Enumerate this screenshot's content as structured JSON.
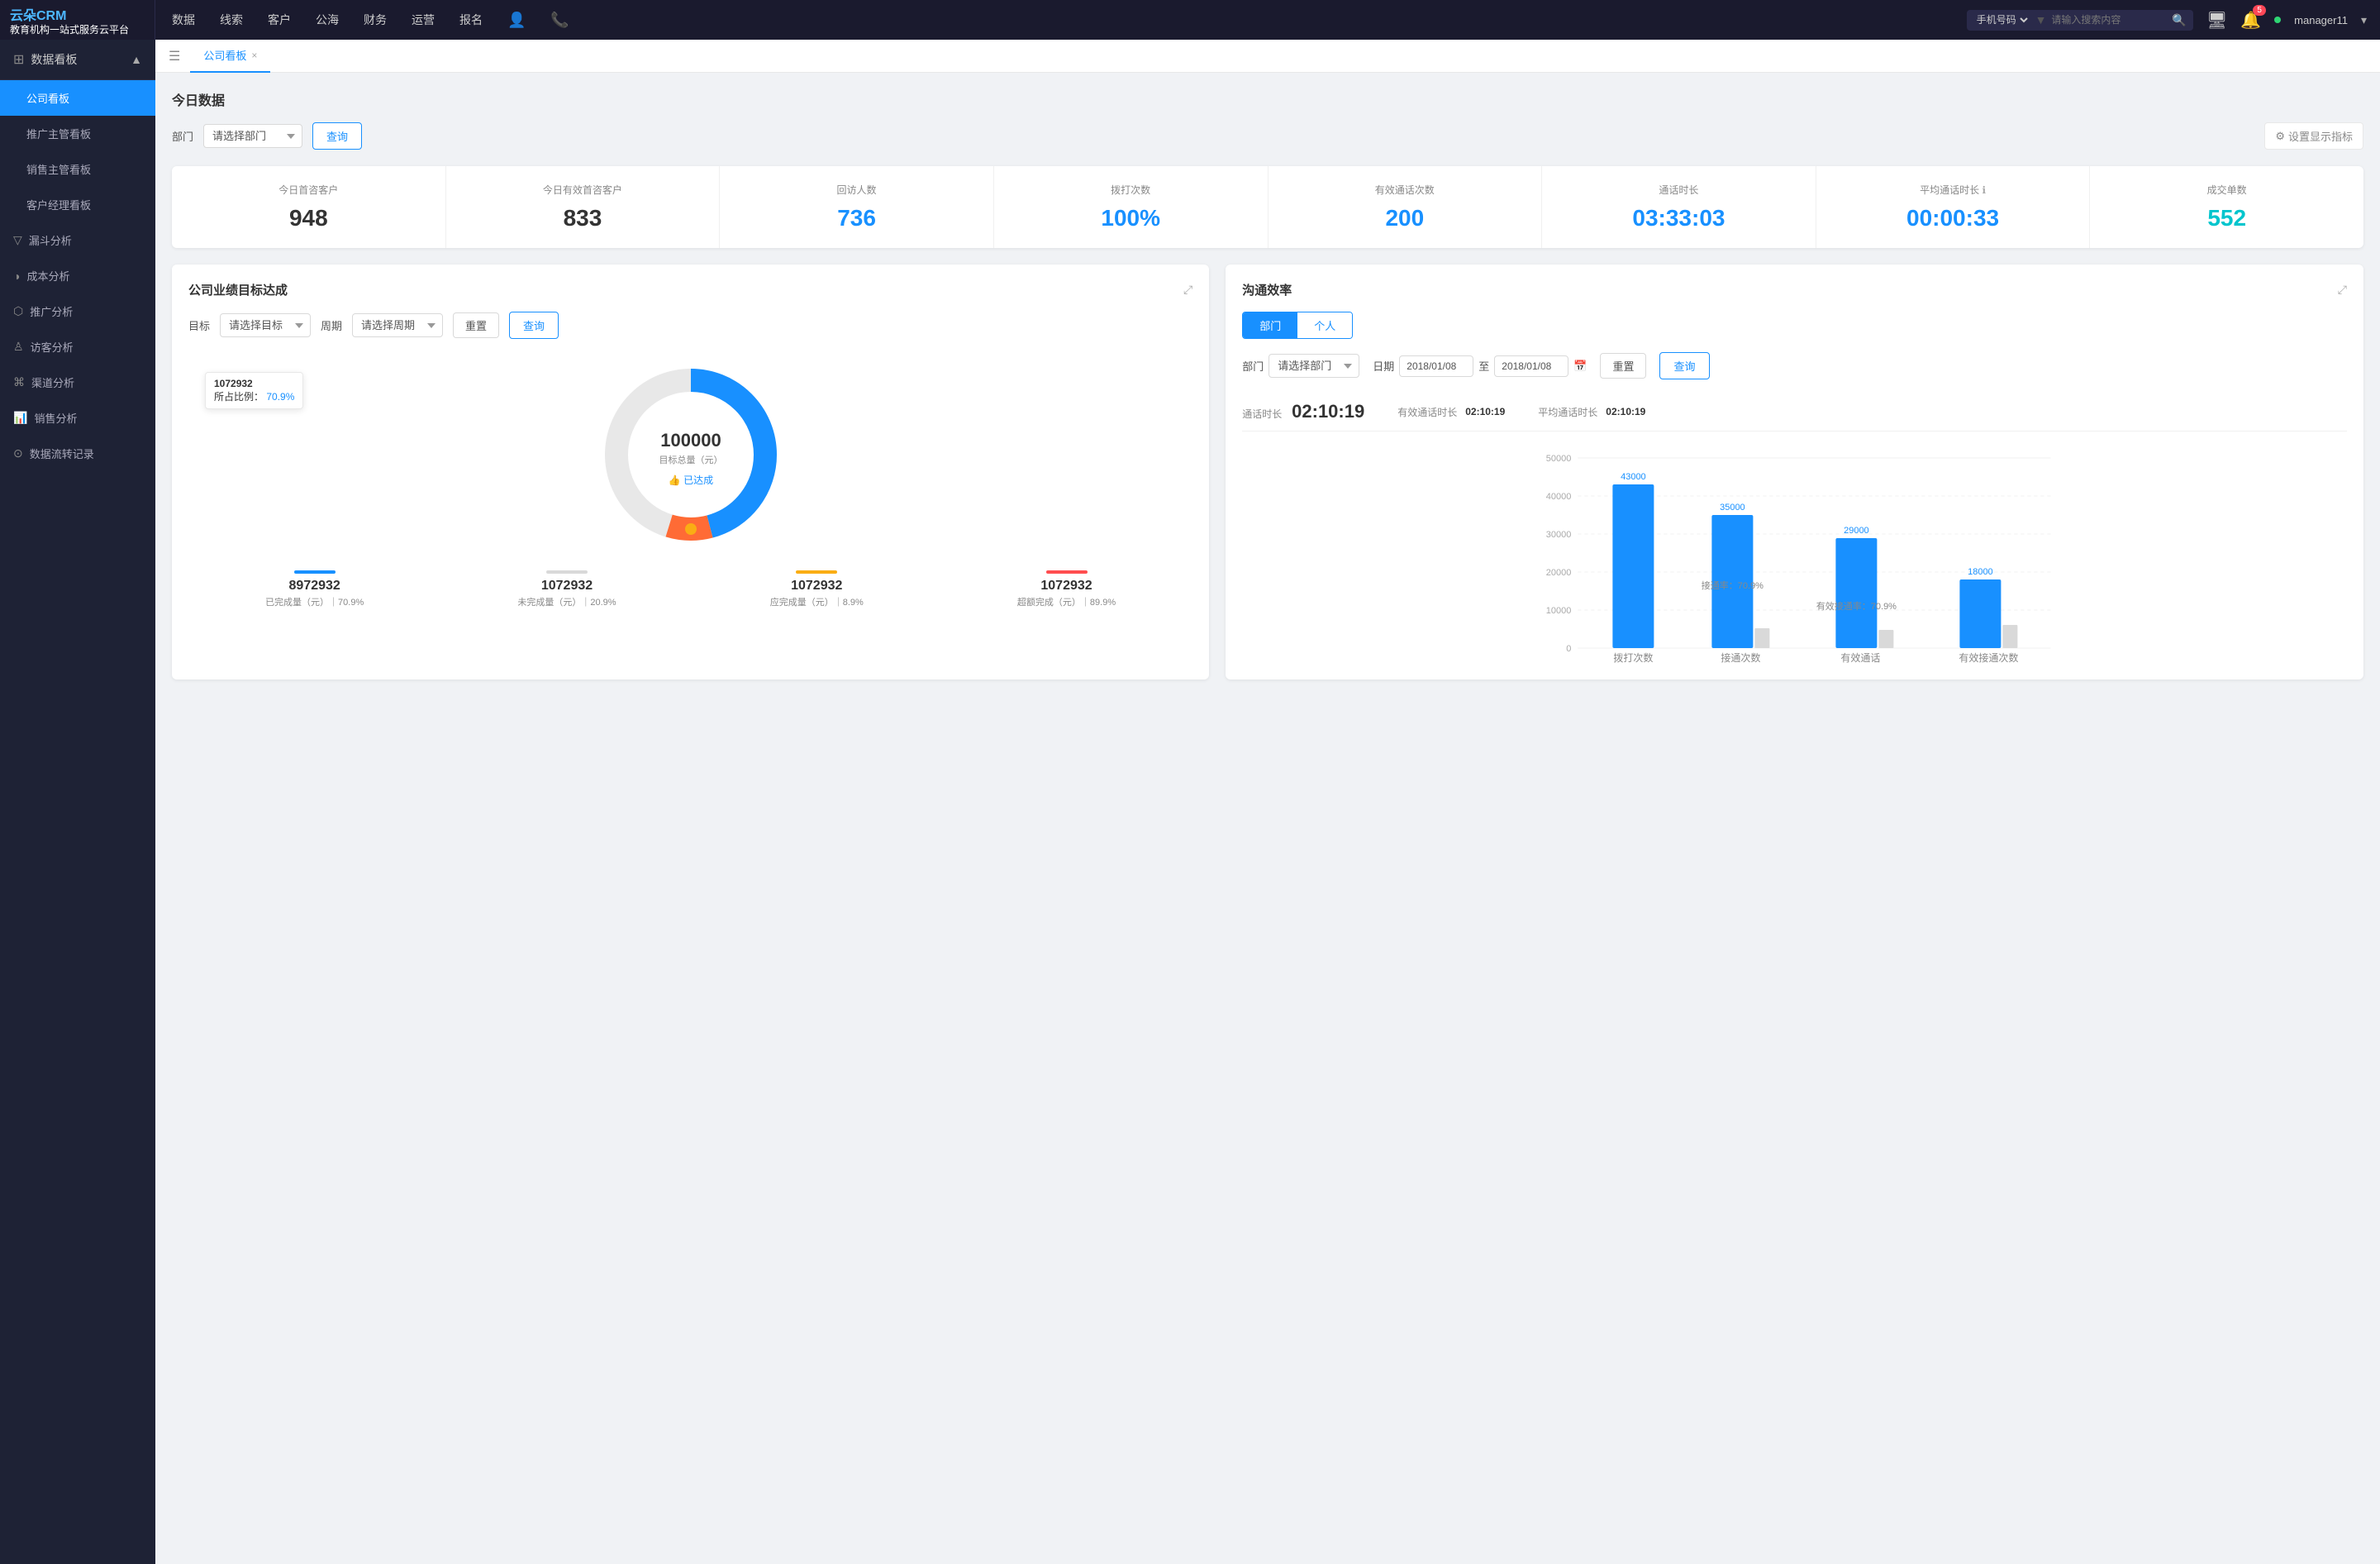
{
  "app": {
    "brand": "云朵CRM",
    "subtitle": "教育机构一站式服务云平台"
  },
  "topNav": {
    "links": [
      "数据",
      "线索",
      "客户",
      "公海",
      "财务",
      "运营",
      "报名"
    ],
    "search": {
      "select_label": "手机号码",
      "placeholder": "请输入搜索内容"
    },
    "badge_count": "5",
    "manager": "manager11"
  },
  "sidebar": {
    "section_title": "数据看板",
    "items": [
      {
        "label": "公司看板",
        "active": true
      },
      {
        "label": "推广主管看板",
        "active": false
      },
      {
        "label": "销售主管看板",
        "active": false
      },
      {
        "label": "客户经理看板",
        "active": false
      }
    ],
    "groups": [
      {
        "label": "漏斗分析",
        "icon": "▽"
      },
      {
        "label": "成本分析",
        "icon": "◑"
      },
      {
        "label": "推广分析",
        "icon": "⬡"
      },
      {
        "label": "访客分析",
        "icon": "♙"
      },
      {
        "label": "渠道分析",
        "icon": "⌘"
      },
      {
        "label": "销售分析",
        "icon": "📊"
      },
      {
        "label": "数据流转记录",
        "icon": "⊙"
      }
    ]
  },
  "tab": {
    "label": "公司看板",
    "close": "×"
  },
  "today_section": {
    "title": "今日数据",
    "dept_label": "部门",
    "dept_placeholder": "请选择部门",
    "query_btn": "查询",
    "settings_btn": "设置显示指标"
  },
  "stats": [
    {
      "label": "今日首咨客户",
      "value": "948",
      "color": "dark"
    },
    {
      "label": "今日有效首咨客户",
      "value": "833",
      "color": "dark"
    },
    {
      "label": "回访人数",
      "value": "736",
      "color": "blue"
    },
    {
      "label": "拨打次数",
      "value": "100%",
      "color": "blue"
    },
    {
      "label": "有效通话次数",
      "value": "200",
      "color": "blue"
    },
    {
      "label": "通话时长",
      "value": "03:33:03",
      "color": "blue"
    },
    {
      "label": "平均通话时长",
      "value": "00:00:33",
      "color": "blue"
    },
    {
      "label": "成交单数",
      "value": "552",
      "color": "cyan"
    }
  ],
  "business_panel": {
    "title": "公司业绩目标达成",
    "target_label": "目标",
    "target_placeholder": "请选择目标",
    "period_label": "周期",
    "period_placeholder": "请选择周期",
    "reset_btn": "重置",
    "query_btn": "查询",
    "donut": {
      "center_value": "100000",
      "center_label": "目标总量（元）",
      "center_sub": "👍 已达成",
      "tooltip_title": "1072932",
      "tooltip_ratio_label": "所占比例：",
      "tooltip_ratio": "70.9%"
    },
    "legend": [
      {
        "label": "8972932",
        "desc": "已完成量（元）｜70.9%",
        "color": "#1890ff"
      },
      {
        "label": "1072932",
        "desc": "未完成量（元）｜20.9%",
        "color": "#d9d9d9"
      },
      {
        "label": "1072932",
        "desc": "应完成量（元）｜8.9%",
        "color": "#faad14"
      },
      {
        "label": "1072932",
        "desc": "超额完成（元）｜89.9%",
        "color": "#ff4d4f"
      }
    ]
  },
  "comm_panel": {
    "title": "沟通效率",
    "tabs": [
      "部门",
      "个人"
    ],
    "active_tab": "部门",
    "dept_label": "部门",
    "dept_placeholder": "请选择部门",
    "date_label": "日期",
    "date_start": "2018/01/08",
    "date_end": "2018/01/08",
    "reset_btn": "重置",
    "query_btn": "查询",
    "stats": {
      "duration_label": "通话时长",
      "duration_val": "02:10:19",
      "eff_label": "有效通话时长",
      "eff_val": "02:10:19",
      "avg_label": "平均通话时长",
      "avg_val": "02:10:19"
    },
    "chart": {
      "y_labels": [
        "50000",
        "40000",
        "30000",
        "20000",
        "10000",
        "0"
      ],
      "x_labels": [
        "拨打次数",
        "接通次数",
        "有效通话",
        "有效接通次数"
      ],
      "bars": [
        {
          "group": "拨打次数",
          "value": 43000,
          "label": "43000",
          "color": "#1890ff"
        },
        {
          "group": "接通次数",
          "value": 35000,
          "label": "35000",
          "color": "#1890ff",
          "ratio_label": "接通率：70.9%",
          "ratio_color": "#888"
        },
        {
          "group": "有效通话",
          "value": 29000,
          "label": "29000",
          "color": "#1890ff",
          "ratio_label": "有效接通率：70.9%",
          "ratio_color": "#888"
        },
        {
          "group": "有效接通次数",
          "value": 18000,
          "label": "18000",
          "color": "#1890ff"
        }
      ],
      "small_bars": [
        {
          "group": "接通次数",
          "value": 0,
          "color": "#d9d9d9"
        },
        {
          "group": "有效通话",
          "value": 0,
          "color": "#d9d9d9"
        },
        {
          "group": "有效接通次数",
          "value": 3000,
          "color": "#d9d9d9"
        }
      ]
    }
  }
}
